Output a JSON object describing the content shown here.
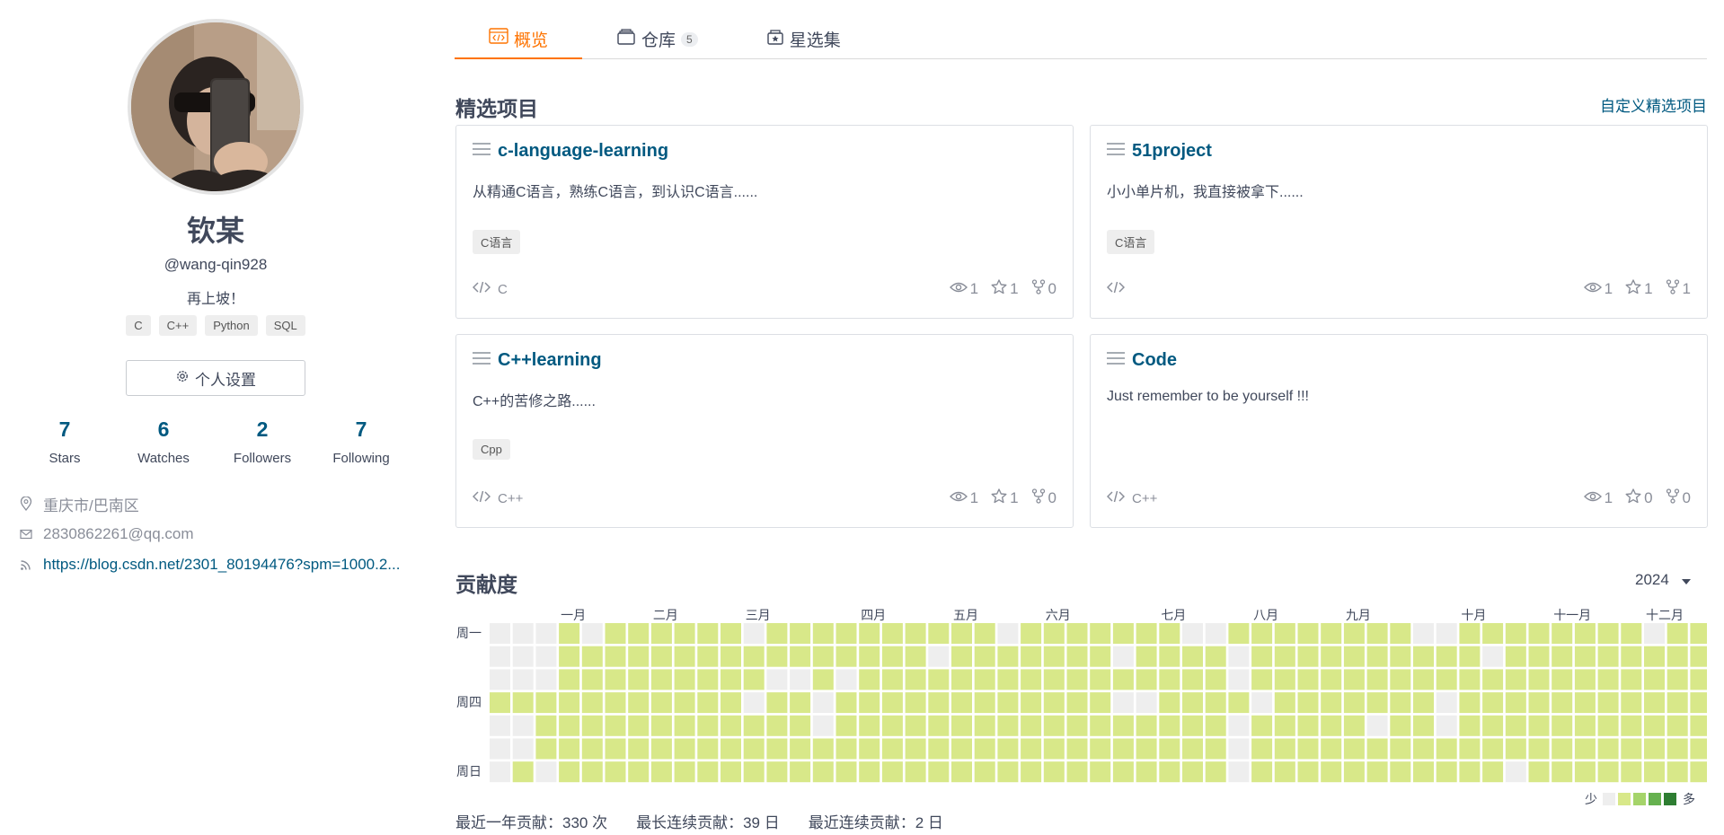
{
  "profile": {
    "name": "钦某",
    "login": "@wang-qin928",
    "bio": "再上坡！",
    "languages": [
      "C",
      "C++",
      "Python",
      "SQL"
    ],
    "settings_label": "个人设置",
    "stats": [
      {
        "value": "7",
        "label": "Stars"
      },
      {
        "value": "6",
        "label": "Watches"
      },
      {
        "value": "2",
        "label": "Followers"
      },
      {
        "value": "7",
        "label": "Following"
      }
    ],
    "location": "重庆市/巴南区",
    "email": "2830862261@qq.com",
    "website": "https://blog.csdn.net/2301_80194476?spm=1000.2..."
  },
  "tabs": [
    {
      "label": "概览",
      "icon": "code-window-icon",
      "active": true
    },
    {
      "label": "仓库",
      "icon": "repo-icon",
      "count": "5"
    },
    {
      "label": "星选集",
      "icon": "star-box-icon"
    }
  ],
  "featured": {
    "title": "精选项目",
    "customize_label": "自定义精选项目",
    "cards": [
      {
        "name": "c-language-learning",
        "desc": "从精通C语言，熟练C语言，到认识C语言......",
        "tag": "C语言",
        "lang": "C",
        "watches": "1",
        "stars": "1",
        "forks": "0"
      },
      {
        "name": "51project",
        "desc": "小小单片机，我直接被拿下......",
        "tag": "C语言",
        "lang": "",
        "watches": "1",
        "stars": "1",
        "forks": "1"
      },
      {
        "name": "C++learning",
        "desc": "C++的苦修之路......",
        "tag": "Cpp",
        "lang": "C++",
        "watches": "1",
        "stars": "1",
        "forks": "0"
      },
      {
        "name": "Code",
        "desc": "Just remember to be yourself !!!",
        "tag": "",
        "lang": "C++",
        "watches": "1",
        "stars": "0",
        "forks": "0"
      }
    ]
  },
  "contributions": {
    "title": "贡献度",
    "year": "2024",
    "months": [
      "一月",
      "二月",
      "三月",
      "四月",
      "五月",
      "六月",
      "七月",
      "八月",
      "九月",
      "十月",
      "十一月",
      "十二月"
    ],
    "month_start_weeks": [
      3,
      7,
      11,
      16,
      20,
      24,
      29,
      33,
      37,
      42,
      46,
      50
    ],
    "weekday_labels": [
      "周一",
      "",
      "",
      "周四",
      "",
      "",
      "周日"
    ],
    "legend_less": "少",
    "legend_more": "多",
    "legend_colors": [
      "#eeeeee",
      "#d8e889",
      "#a5d46a",
      "#66b14f",
      "#2e7d32"
    ],
    "total_label": "最近一年贡献：330 次",
    "longest_label": "最长连续贡献：39 日",
    "current_label": "最近连续贡献：2 日",
    "grid_rows": [
      "0001011111101111111111011111110011111111001111111101110111111111110",
      "0001111111111111111011111110111101111111111011111111111111111111111",
      "0001111111110010111111111111111101111111111111111111111111111110111",
      "1111111111101101111111111110011110111111101111111111111110111111110",
      "0011111111111101111111111111111101111101101111111111111111111111111",
      "0011111111111111111111111111111101111111111111111111111111111111111",
      "0101111111111111111111111111111101111111111101111111111111011111111"
    ]
  }
}
